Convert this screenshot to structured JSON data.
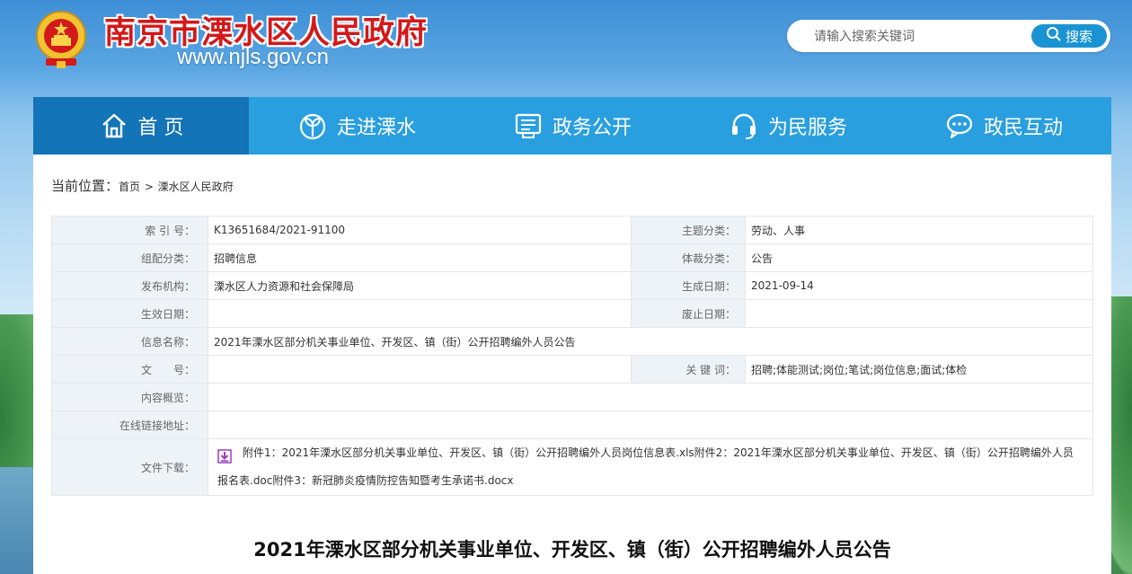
{
  "header": {
    "site_title": "南京市溧水区人民政府",
    "site_url": "www.njls.gov.cn",
    "search_placeholder": "请输入搜索关键词",
    "search_button": "搜索"
  },
  "nav": [
    {
      "label": "首 页",
      "icon": "home-icon",
      "active": true
    },
    {
      "label": "走进溧水",
      "icon": "sprout-icon",
      "active": false
    },
    {
      "label": "政务公开",
      "icon": "document-icon",
      "active": false
    },
    {
      "label": "为民服务",
      "icon": "headset-icon",
      "active": false
    },
    {
      "label": "政民互动",
      "icon": "chat-icon",
      "active": false
    }
  ],
  "breadcrumb": {
    "prefix": "当前位置：",
    "home": "首页",
    "sep": ">",
    "current": "溧水区人民政府"
  },
  "meta": {
    "index_label": "索 引 号：",
    "index_value": "K13651684/2021-91100",
    "topic_label": "主题分类：",
    "topic_value": "劳动、人事",
    "org_cat_label": "组配分类：",
    "org_cat_value": "招聘信息",
    "genre_label": "体裁分类：",
    "genre_value": "公告",
    "publisher_label": "发布机构：",
    "publisher_value": "溧水区人力资源和社会保障局",
    "created_label": "生成日期：",
    "created_value": "2021-09-14",
    "effective_label": "生效日期：",
    "effective_value": "",
    "abolish_label": "废止日期：",
    "abolish_value": "",
    "info_name_label": "信息名称：",
    "info_name_value": "2021年溧水区部分机关事业单位、开发区、镇（街）公开招聘编外人员公告",
    "doc_no_label": "文　　号：",
    "doc_no_value": "",
    "keywords_label": "关 键 词：",
    "keywords_value": "招聘;体能测试;岗位;笔试;岗位信息;面试;体检",
    "summary_label": "内容概览：",
    "summary_value": "",
    "link_label": "在线链接地址：",
    "link_value": "",
    "download_label": "文件下载：",
    "download_value": "附件1：2021年溧水区部分机关事业单位、开发区、镇（街）公开招聘编外人员岗位信息表.xls附件2：2021年溧水区部分机关事业单位、开发区、镇（街）公开招聘编外人员报名表.doc附件3：新冠肺炎疫情防控告知暨考生承诺书.docx"
  },
  "article": {
    "title": "2021年溧水区部分机关事业单位、开发区、镇（街）公开招聘编外人员公告"
  },
  "colors": {
    "nav_bg": "#2a9fe0",
    "nav_active": "#1374b8",
    "title_red": "#d3191a",
    "search_btn": "#1a93d3",
    "label_bg": "#eef3f8"
  }
}
